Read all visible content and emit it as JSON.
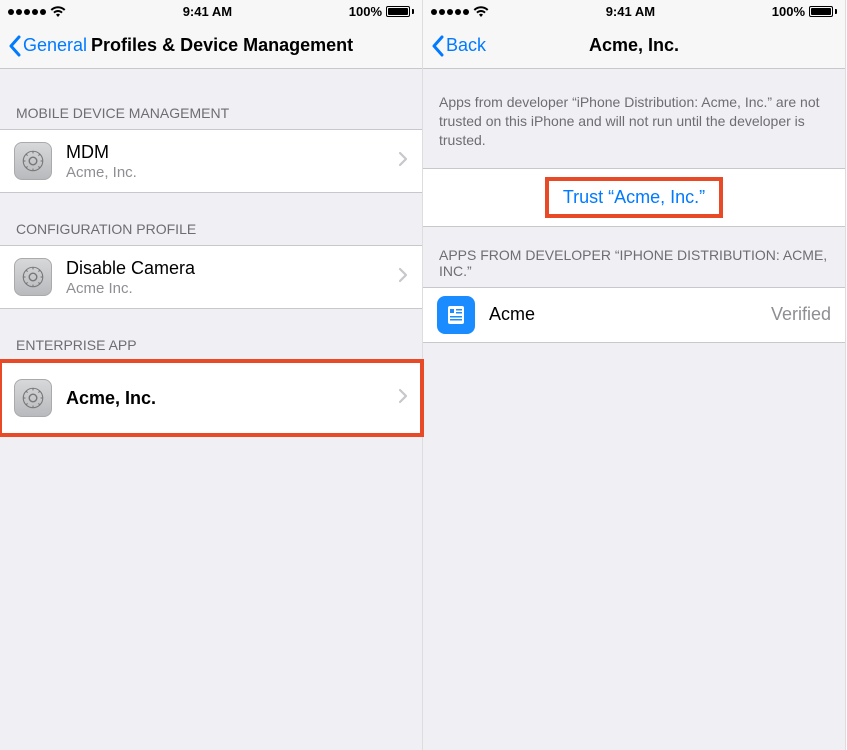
{
  "status": {
    "time": "9:41 AM",
    "battery_pct": "100%"
  },
  "left": {
    "back_label": "General",
    "title": "Profiles & Device Management",
    "sections": {
      "mdm": {
        "header": "Mobile Device Management",
        "item": {
          "title": "MDM",
          "sub": "Acme, Inc."
        }
      },
      "config": {
        "header": "Configuration Profile",
        "item": {
          "title": "Disable Camera",
          "sub": "Acme Inc."
        }
      },
      "enterprise": {
        "header": "Enterprise App",
        "item": {
          "title": "Acme, Inc."
        }
      }
    }
  },
  "right": {
    "back_label": "Back",
    "title": "Acme, Inc.",
    "note": "Apps from developer “iPhone Distribution: Acme, Inc.” are not trusted on this iPhone and will not run until the developer is trusted.",
    "trust_button": "Trust “Acme, Inc.”",
    "apps_header": "Apps from Developer “iPhone Distribution: Acme, Inc.”",
    "app": {
      "title": "Acme",
      "status": "Verified"
    }
  }
}
